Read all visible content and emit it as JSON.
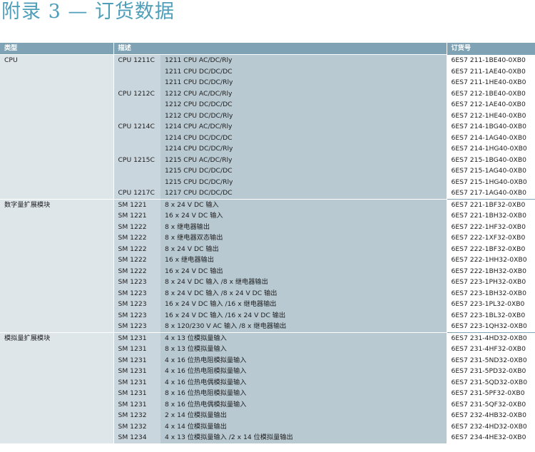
{
  "title": "附录 3 — 订货数据",
  "headers": {
    "type": "类型",
    "desc": "描述",
    "order": "订货号"
  },
  "groups": [
    {
      "type": "CPU",
      "rows": [
        {
          "model": "CPU 1211C",
          "desc": "1211 CPU AC/DC/Rly",
          "order": "6ES7 211-1BE40-0XB0"
        },
        {
          "model": "",
          "desc": "1211 CPU DC/DC/DC",
          "order": "6ES7 211-1AE40-0XB0"
        },
        {
          "model": "",
          "desc": "1211 CPU DC/DC/Rly",
          "order": "6ES7 211-1HE40-0XB0"
        },
        {
          "model": "CPU 1212C",
          "desc": "1212 CPU AC/DC/Rly",
          "order": "6ES7 212-1BE40-0XB0"
        },
        {
          "model": "",
          "desc": "1212 CPU DC/DC/DC",
          "order": "6ES7 212-1AE40-0XB0"
        },
        {
          "model": "",
          "desc": "1212 CPU DC/DC/Rly",
          "order": "6ES7 212-1HE40-0XB0"
        },
        {
          "model": "CPU 1214C",
          "desc": "1214 CPU AC/DC/Rly",
          "order": "6ES7 214-1BG40-0XB0"
        },
        {
          "model": "",
          "desc": "1214 CPU DC/DC/DC",
          "order": "6ES7 214-1AG40-0XB0"
        },
        {
          "model": "",
          "desc": "1214 CPU DC/DC/Rly",
          "order": "6ES7 214-1HG40-0XB0"
        },
        {
          "model": "CPU 1215C",
          "desc": "1215 CPU AC/DC/Rly",
          "order": "6ES7 215-1BG40-0XB0"
        },
        {
          "model": "",
          "desc": "1215 CPU DC/DC/DC",
          "order": "6ES7 215-1AG40-0XB0"
        },
        {
          "model": "",
          "desc": "1215 CPU DC/DC/Rly",
          "order": "6ES7 215-1HG40-0XB0"
        },
        {
          "model": "CPU 1217C",
          "desc": "1217 CPU DC/DC/DC",
          "order": "6ES7 217-1AG40-0XB0"
        }
      ]
    },
    {
      "type": "数字量扩展模块",
      "rows": [
        {
          "model": "SM 1221",
          "desc": "8 x 24 V DC 输入",
          "order": "6ES7 221-1BF32-0XB0"
        },
        {
          "model": "SM 1221",
          "desc": "16 x 24 V DC 输入",
          "order": "6ES7 221-1BH32-0XB0"
        },
        {
          "model": "SM 1222",
          "desc": "8 x 继电器输出",
          "order": "6ES7 222-1HF32-0XB0"
        },
        {
          "model": "SM 1222",
          "desc": "8 x 继电器双态输出",
          "order": "6ES7 222-1XF32-0XB0"
        },
        {
          "model": "SM 1222",
          "desc": "8 x 24 V DC 输出",
          "order": "6ES7 222-1BF32-0XB0"
        },
        {
          "model": "SM 1222",
          "desc": "16 x 继电器输出",
          "order": "6ES7 222-1HH32-0XB0"
        },
        {
          "model": "SM 1222",
          "desc": "16 x 24 V DC 输出",
          "order": "6ES7 222-1BH32-0XB0"
        },
        {
          "model": "SM 1223",
          "desc": "8 x 24 V DC 输入 /8 x 继电器输出",
          "order": "6ES7 223-1PH32-0XB0"
        },
        {
          "model": "SM 1223",
          "desc": "8 x 24 V DC 输入 /8 x 24 V DC 输出",
          "order": "6ES7 223-1BH32-0XB0"
        },
        {
          "model": "SM 1223",
          "desc": "16 x 24 V DC 输入 /16 x 继电器输出",
          "order": "6ES7 223-1PL32-0XB0"
        },
        {
          "model": "SM 1223",
          "desc": "16 x 24 V DC 输入 /16 x 24 V DC 输出",
          "order": "6ES7 223-1BL32-0XB0"
        },
        {
          "model": "SM 1223",
          "desc": "8 x 120/230 V AC 输入 /8 x 继电器输出",
          "order": "6ES7 223-1QH32-0XB0"
        }
      ]
    },
    {
      "type": "模拟量扩展模块",
      "rows": [
        {
          "model": "SM 1231",
          "desc": "4 x 13 位模拟量输入",
          "order": "6ES7 231-4HD32-0XB0"
        },
        {
          "model": "SM 1231",
          "desc": "8 x 13 位模拟量输入",
          "order": "6ES7 231-4HF32-0XB0"
        },
        {
          "model": "SM 1231",
          "desc": "4 x 16 位热电阻模拟量输入",
          "order": "6ES7 231-5ND32-0XB0"
        },
        {
          "model": "SM 1231",
          "desc": "4 x 16 位热电阻模拟量输入",
          "order": "6ES7 231-5PD32-0XB0"
        },
        {
          "model": "SM 1231",
          "desc": "4 x 16 位热电偶模拟量输入",
          "order": "6ES7 231-5QD32-0XB0"
        },
        {
          "model": "SM 1231",
          "desc": "8 x 16 位热电阻模拟量输入",
          "order": "6ES7 231-5PF32-0XB0"
        },
        {
          "model": "SM 1231",
          "desc": "8 x 16 位热电偶模拟量输入",
          "order": "6ES7 231-5QF32-0XB0"
        },
        {
          "model": "SM 1232",
          "desc": "2 x 14 位模拟量输出",
          "order": "6ES7 232-4HB32-0XB0"
        },
        {
          "model": "SM 1232",
          "desc": "4 x 14 位模拟量输出",
          "order": "6ES7 232-4HD32-0XB0"
        },
        {
          "model": "SM 1234",
          "desc": "4 x 13 位模拟量输入 /2 x 14 位模拟量输出",
          "order": "6ES7 234-4HE32-0XB0"
        }
      ]
    }
  ]
}
